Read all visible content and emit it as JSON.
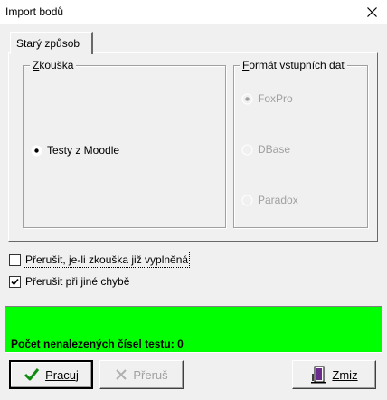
{
  "window": {
    "title": "Import bodů"
  },
  "tabs": [
    {
      "label": "Starý způsob",
      "active": true
    }
  ],
  "exam_group": {
    "caption": "Zkouška",
    "options": [
      {
        "label": "Testy z Moodle",
        "selected": true,
        "enabled": true
      }
    ]
  },
  "format_group": {
    "caption": "Formát vstupních dat",
    "options": [
      {
        "label": "FoxPro",
        "selected": true,
        "enabled": false
      },
      {
        "label": "DBase",
        "selected": false,
        "enabled": false
      },
      {
        "label": "Paradox",
        "selected": false,
        "enabled": false
      }
    ]
  },
  "checkboxes": [
    {
      "label": "Přerušit, je-li zkouška již vyplněná",
      "checked": false,
      "focused": true
    },
    {
      "label": "Přerušit při jiné chybě",
      "checked": true,
      "focused": false
    }
  ],
  "status": {
    "text": "Počet nenalezených čísel testu: 0",
    "color": "#00ff00"
  },
  "buttons": {
    "run": {
      "label": "Pracuj",
      "icon": "check-icon",
      "enabled": true
    },
    "stop": {
      "label": "Přeruš",
      "icon": "x-icon",
      "enabled": false
    },
    "close": {
      "label": "Zmiz",
      "icon": "door-exit-icon",
      "enabled": true
    }
  }
}
